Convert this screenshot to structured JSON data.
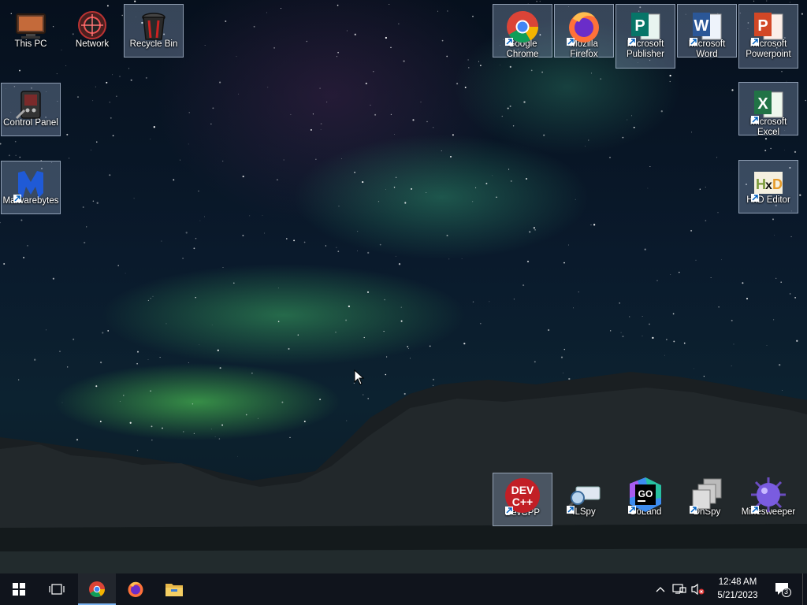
{
  "desktop": {
    "icons_left": [
      {
        "id": "this-pc",
        "label": "This PC"
      },
      {
        "id": "network",
        "label": "Network"
      },
      {
        "id": "recycle-bin",
        "label": "Recycle Bin"
      },
      {
        "id": "control-panel",
        "label": "Control Panel"
      },
      {
        "id": "malwarebytes",
        "label": "Malwarebytes"
      }
    ],
    "icons_right": [
      {
        "id": "google-chrome",
        "label": "Google Chrome"
      },
      {
        "id": "mozilla-firefox",
        "label": "Mozilla Firefox"
      },
      {
        "id": "microsoft-publisher",
        "label": "Microsoft Publisher"
      },
      {
        "id": "microsoft-word",
        "label": "Microsoft Word"
      },
      {
        "id": "microsoft-powerpoint",
        "label": "Microsoft Powerpoint"
      },
      {
        "id": "microsoft-excel",
        "label": "Microsoft Excel"
      },
      {
        "id": "hxd-editor",
        "label": "HxD Editor"
      }
    ],
    "icons_bottom": [
      {
        "id": "devcpp",
        "label": "DevCPP"
      },
      {
        "id": "ilspy",
        "label": "ILSpy"
      },
      {
        "id": "goland",
        "label": "GoLand"
      },
      {
        "id": "dnspy",
        "label": "DnSpy"
      },
      {
        "id": "minesweeper",
        "label": "Minesweeper"
      }
    ],
    "devcpp_text_1": "DEV",
    "devcpp_text_2": "C++",
    "goland_text": "GO"
  },
  "taskbar": {
    "pinned": [
      "start-icon",
      "task-view-icon",
      "chrome-icon",
      "firefox-icon",
      "file-explorer-icon"
    ],
    "clock": {
      "time": "12:48 AM",
      "date": "5/21/2023"
    },
    "notification_count": "3"
  },
  "colors": {
    "taskbar_bg": "#10141c",
    "accent": "#7bb3f0",
    "selection": "#96aac8"
  }
}
